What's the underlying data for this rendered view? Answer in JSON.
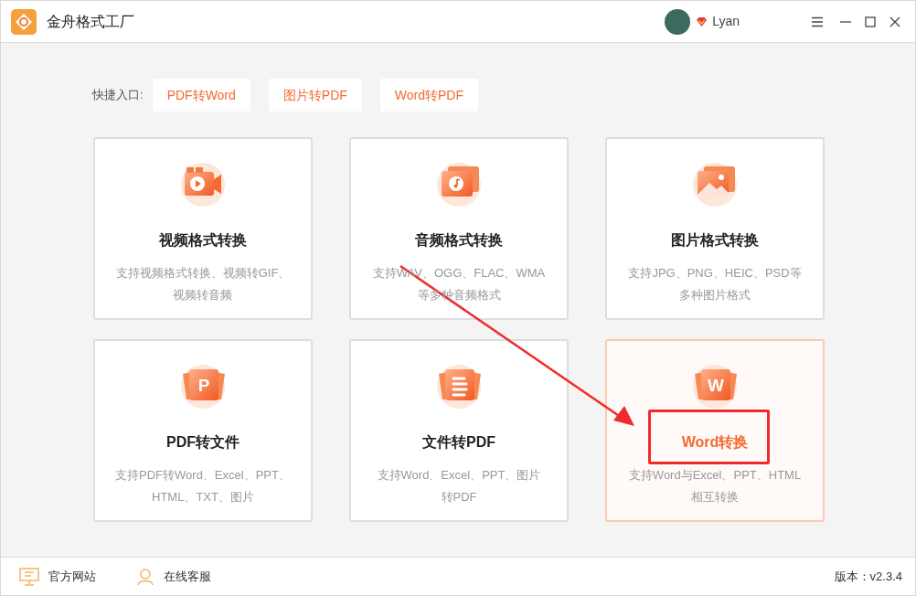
{
  "window": {
    "title": "金舟格式工厂",
    "user": "Lyan"
  },
  "quick_entry": {
    "label": "快捷入口:",
    "links": [
      "PDF转Word",
      "图片转PDF",
      "Word转PDF"
    ]
  },
  "cards": [
    {
      "kind": "video",
      "title": "视频格式转换",
      "description": [
        "支持视频格式转换、视频转GIF、",
        "视频转音频"
      ],
      "selected": false
    },
    {
      "kind": "audio",
      "title": "音频格式转换",
      "description": [
        "支持WAV、OGG、FLAC、WMA",
        "等多种音频格式"
      ],
      "selected": false
    },
    {
      "kind": "image",
      "title": "图片格式转换",
      "description": [
        "支持JPG、PNG、HEIC、PSD等",
        "多种图片格式"
      ],
      "selected": false
    },
    {
      "kind": "pdf",
      "icon_letter": "P",
      "title": "PDF转文件",
      "description": [
        "支持PDF转Word、Excel、PPT、",
        "HTML、TXT、图片"
      ],
      "selected": false
    },
    {
      "kind": "doc",
      "title": "文件转PDF",
      "description": [
        "支持Word、Excel、PPT、图片",
        "转PDF"
      ],
      "selected": false
    },
    {
      "kind": "word",
      "icon_letter": "W",
      "title": "Word转换",
      "description": [
        "支持Word与Excel、PPT、HTML",
        "相互转换"
      ],
      "selected": true
    }
  ],
  "status_bar": {
    "links": [
      {
        "kind": "website",
        "label": "官方网站"
      },
      {
        "kind": "support",
        "label": "在线客服"
      }
    ],
    "version": "版本：v2.3.4"
  }
}
